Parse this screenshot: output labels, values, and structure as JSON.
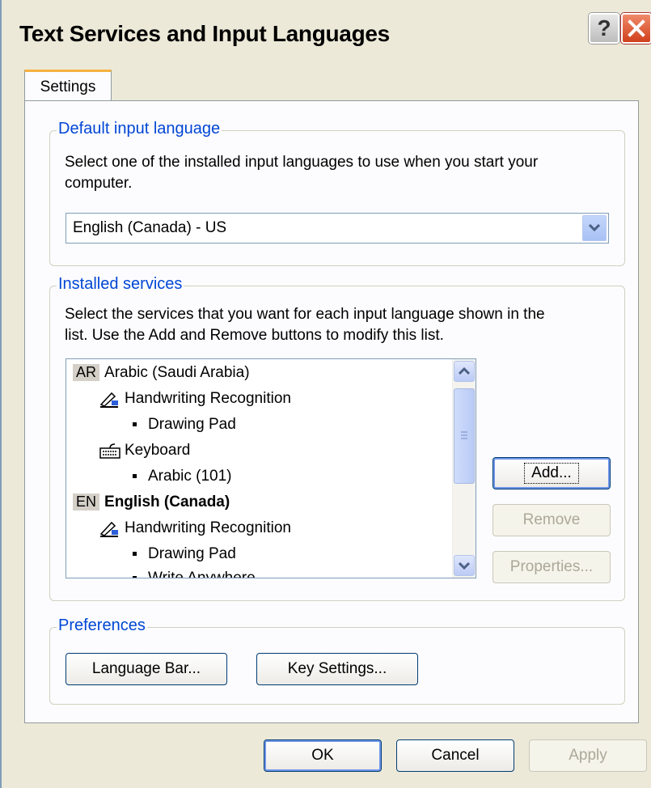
{
  "window": {
    "title": "Text Services and Input Languages",
    "help_label": "?"
  },
  "tabs": [
    {
      "label": "Settings"
    }
  ],
  "default_language": {
    "legend": "Default input language",
    "description_line1": "Select one of the installed input languages to use when you start your",
    "description_line2": "computer.",
    "selected": "English (Canada) - US"
  },
  "installed_services": {
    "legend": "Installed services",
    "description_line1": "Select the services that you want for each input language shown in the",
    "description_line2": "list. Use the Add and Remove buttons to modify this list.",
    "items": [
      {
        "abbr": "AR",
        "label": "Arabic (Saudi Arabia)"
      },
      {
        "label": "Handwriting Recognition"
      },
      {
        "label": "Drawing Pad"
      },
      {
        "label": "Keyboard"
      },
      {
        "label": "Arabic (101)"
      },
      {
        "abbr": "EN",
        "label": "English (Canada)"
      },
      {
        "label": "Handwriting Recognition"
      },
      {
        "label": "Drawing Pad"
      },
      {
        "label": "Write Anywhere"
      }
    ],
    "add_label": "Add...",
    "remove_label": "Remove",
    "properties_label": "Properties..."
  },
  "preferences": {
    "legend": "Preferences",
    "language_bar_label": "Language Bar...",
    "key_settings_label": "Key Settings..."
  },
  "footer": {
    "ok_label": "OK",
    "cancel_label": "Cancel",
    "apply_label": "Apply"
  },
  "colors": {
    "legend": "#0046d5",
    "title_bar": "#ece9d8",
    "close": "#d0401c"
  }
}
